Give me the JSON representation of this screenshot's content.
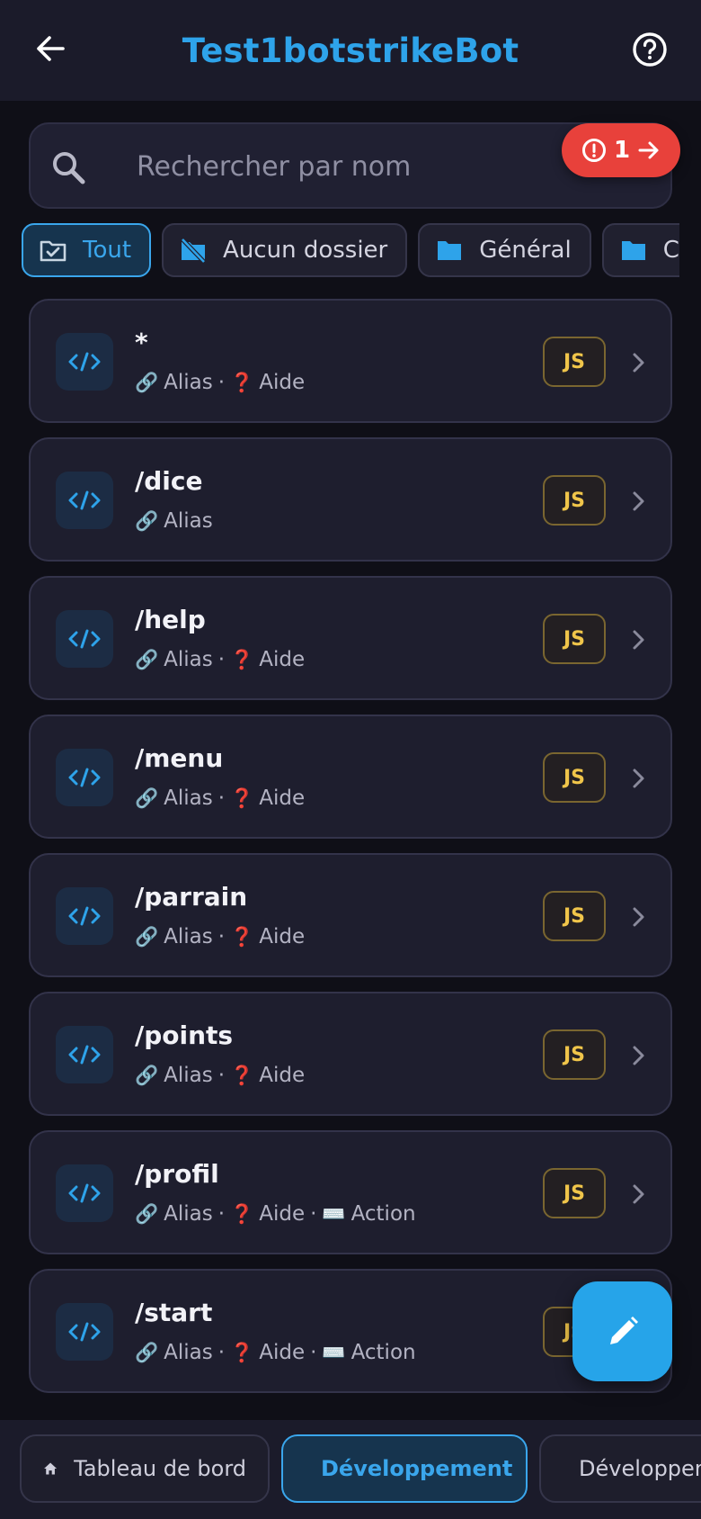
{
  "header": {
    "title": "Test1botstrikeBot"
  },
  "search": {
    "placeholder": "Rechercher par nom"
  },
  "error_badge": {
    "count": "1"
  },
  "filters": [
    {
      "label": "Tout",
      "icon": "folder-check-icon",
      "active": true
    },
    {
      "label": "Aucun dossier",
      "icon": "folder-off-icon",
      "active": false
    },
    {
      "label": "Général",
      "icon": "folder-icon",
      "active": false
    },
    {
      "label": "Co",
      "icon": "folder-icon",
      "active": false
    }
  ],
  "commands": [
    {
      "name": "*",
      "meta": [
        {
          "emoji": "🔗",
          "text": "Alias"
        },
        {
          "emoji": "❓",
          "text": "Aide"
        }
      ],
      "lang": "JS"
    },
    {
      "name": "/dice",
      "meta": [
        {
          "emoji": "🔗",
          "text": "Alias"
        }
      ],
      "lang": "JS"
    },
    {
      "name": "/help",
      "meta": [
        {
          "emoji": "🔗",
          "text": "Alias"
        },
        {
          "emoji": "❓",
          "text": "Aide"
        }
      ],
      "lang": "JS"
    },
    {
      "name": "/menu",
      "meta": [
        {
          "emoji": "🔗",
          "text": "Alias"
        },
        {
          "emoji": "❓",
          "text": "Aide"
        }
      ],
      "lang": "JS"
    },
    {
      "name": "/parrain",
      "meta": [
        {
          "emoji": "🔗",
          "text": "Alias"
        },
        {
          "emoji": "❓",
          "text": "Aide"
        }
      ],
      "lang": "JS"
    },
    {
      "name": "/points",
      "meta": [
        {
          "emoji": "🔗",
          "text": "Alias"
        },
        {
          "emoji": "❓",
          "text": "Aide"
        }
      ],
      "lang": "JS"
    },
    {
      "name": "/profil",
      "meta": [
        {
          "emoji": "🔗",
          "text": "Alias"
        },
        {
          "emoji": "❓",
          "text": "Aide"
        },
        {
          "emoji": "⌨️",
          "text": "Action"
        }
      ],
      "lang": "JS"
    },
    {
      "name": "/start",
      "meta": [
        {
          "emoji": "🔗",
          "text": "Alias"
        },
        {
          "emoji": "❓",
          "text": "Aide"
        },
        {
          "emoji": "⌨️",
          "text": "Action"
        }
      ],
      "lang": "JS"
    }
  ],
  "meta_separator": "·",
  "bottom_nav": [
    {
      "label": "Tableau de bord",
      "icon": "home-icon",
      "active": false
    },
    {
      "label": "Développement",
      "icon": "code-icon",
      "active": true
    },
    {
      "label": "Développement IA",
      "icon": "sparkles-icon",
      "active": false
    }
  ],
  "colors": {
    "accent": "#2ea3ea",
    "error": "#e8413b",
    "js_badge": "#f0c54a"
  }
}
